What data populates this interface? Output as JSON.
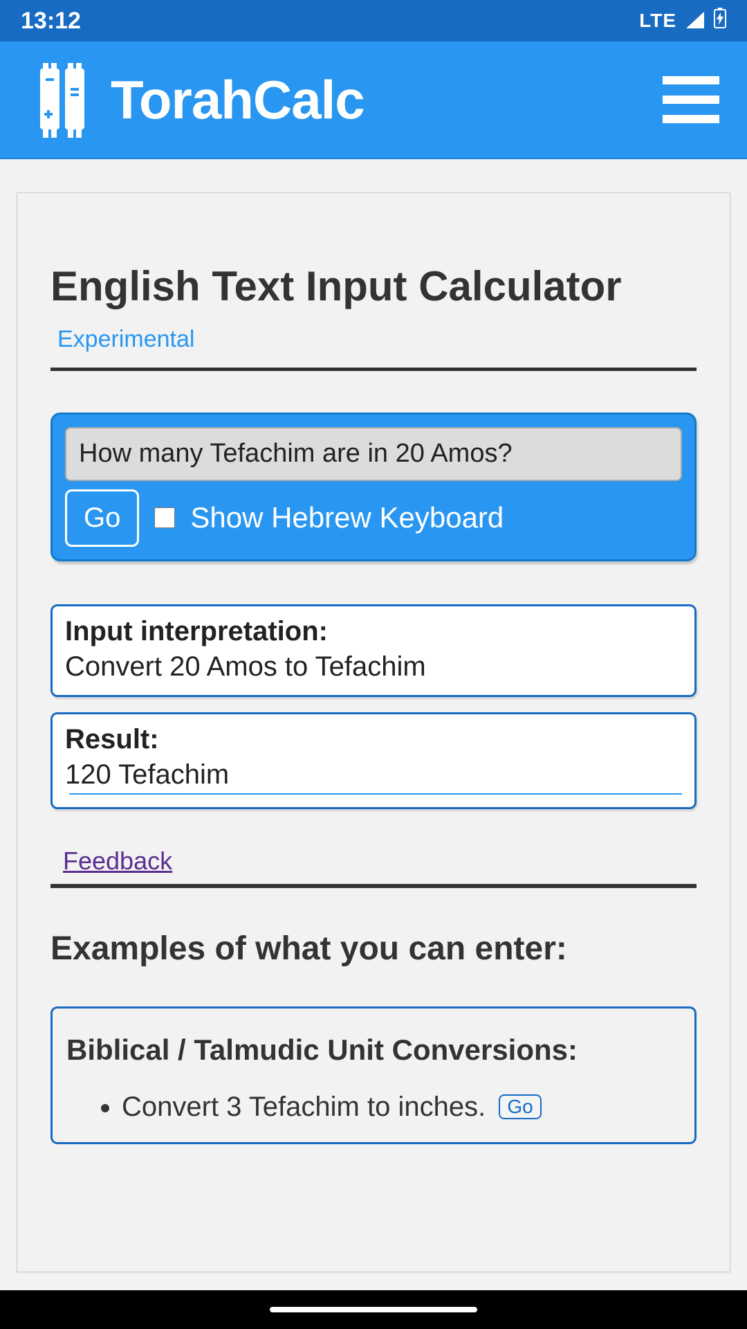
{
  "status": {
    "time": "13:12",
    "network": "LTE"
  },
  "header": {
    "brand": "TorahCalc"
  },
  "main": {
    "title": "English Text Input Calculator",
    "badge": "Experimental",
    "query": {
      "value": "How many Tefachim are in 20 Amos?",
      "go_label": "Go",
      "keyboard_label": "Show Hebrew Keyboard"
    },
    "interpretation": {
      "label": "Input interpretation:",
      "value": "Convert 20 Amos to Tefachim"
    },
    "result": {
      "label": "Result:",
      "value": "120 Tefachim"
    },
    "feedback_label": "Feedback",
    "examples_heading": "Examples of what you can enter:",
    "examples_group": {
      "title": "Biblical / Talmudic Unit Conversions:",
      "items": [
        {
          "text": "Convert 3 Tefachim to inches.",
          "go": "Go"
        }
      ]
    }
  }
}
